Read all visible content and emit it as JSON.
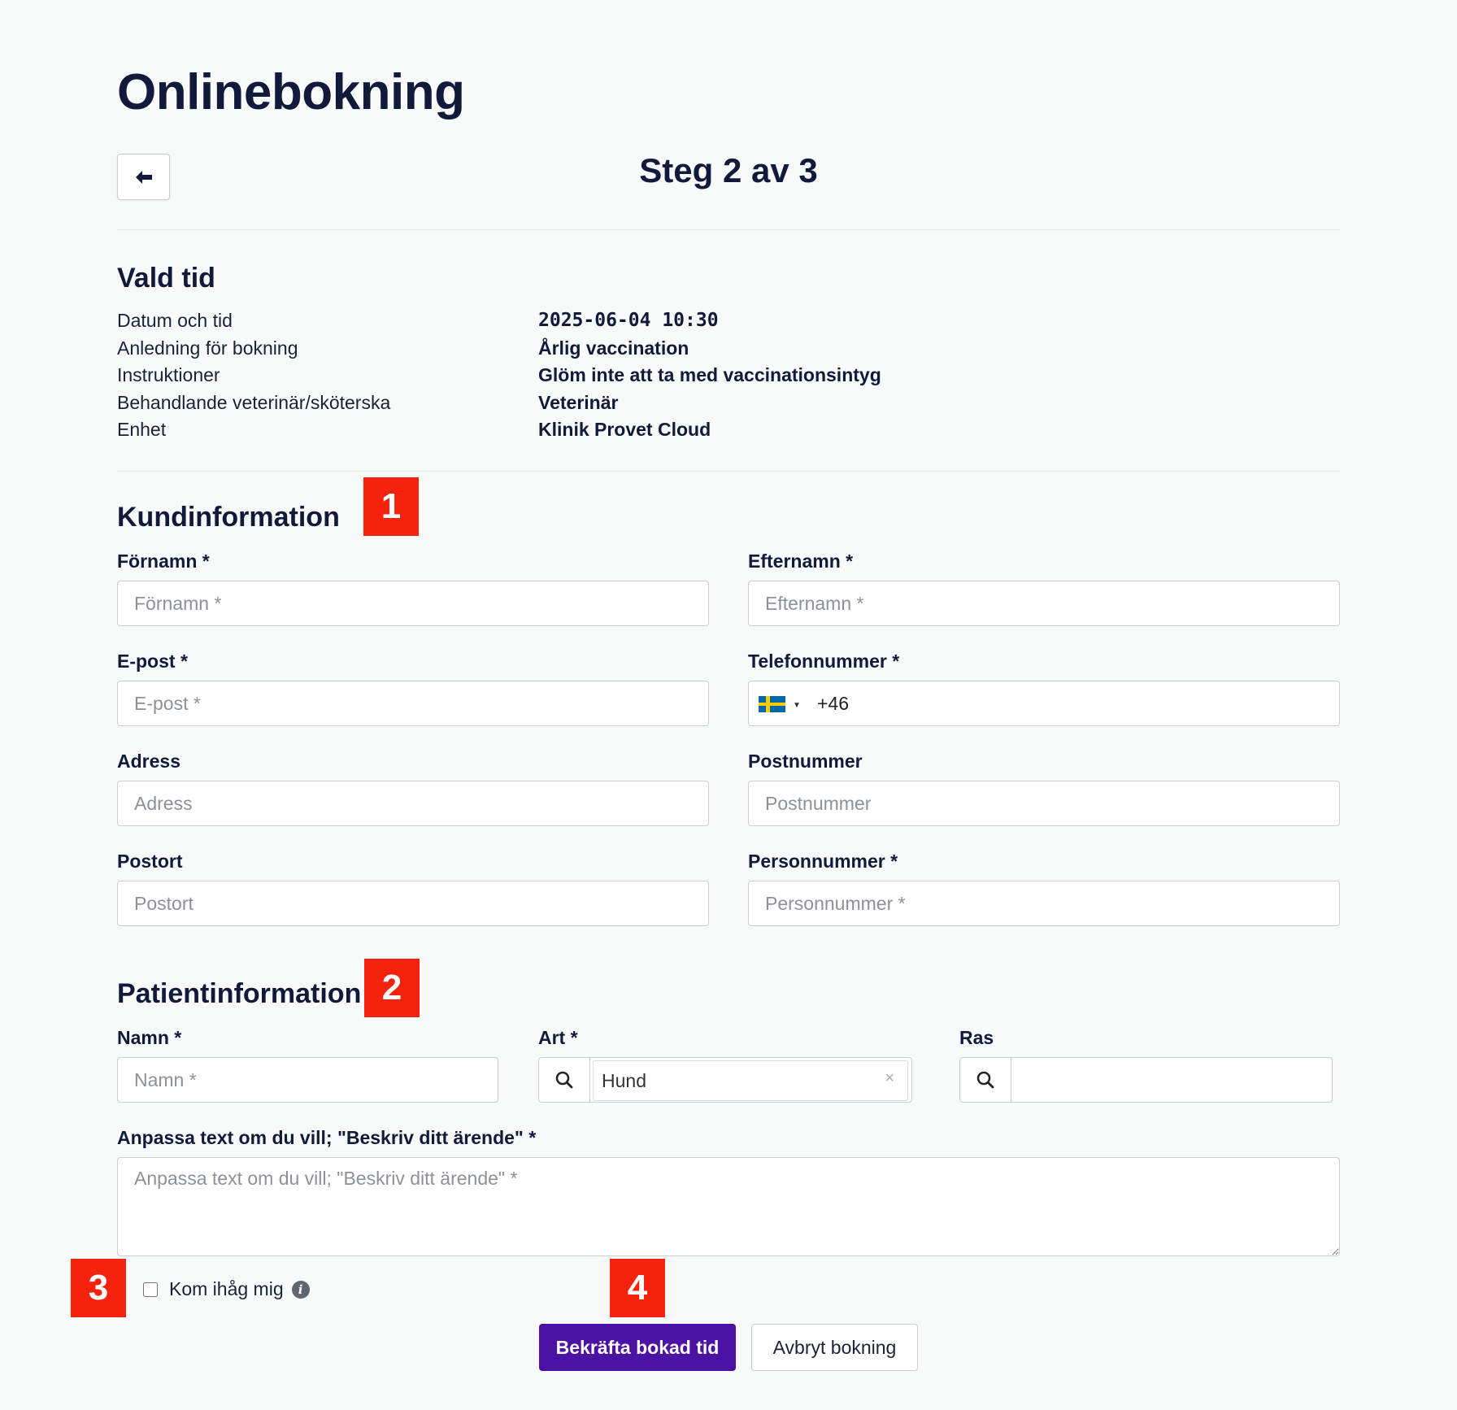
{
  "page": {
    "title": "Onlinebokning",
    "step": "Steg 2 av 3"
  },
  "chosen_time": {
    "heading": "Vald tid",
    "rows": [
      {
        "label": "Datum och tid",
        "value": "2025-06-04 10:30"
      },
      {
        "label": "Anledning för bokning",
        "value": "Årlig vaccination"
      },
      {
        "label": "Instruktioner",
        "value": "Glöm inte att ta med vaccinationsintyg"
      },
      {
        "label": "Behandlande veterinär/sköterska",
        "value": "Veterinär"
      },
      {
        "label": "Enhet",
        "value": "Klinik Provet Cloud"
      }
    ]
  },
  "customer": {
    "heading": "Kundinformation",
    "badge": "1",
    "first_name": {
      "label": "Förnamn *",
      "placeholder": "Förnamn *"
    },
    "last_name": {
      "label": "Efternamn *",
      "placeholder": "Efternamn *"
    },
    "email": {
      "label": "E-post *",
      "placeholder": "E-post *"
    },
    "phone": {
      "label": "Telefonnummer *",
      "country_code": "+46",
      "flag_icon": "sweden-flag-icon"
    },
    "address": {
      "label": "Adress",
      "placeholder": "Adress"
    },
    "postal_code": {
      "label": "Postnummer",
      "placeholder": "Postnummer"
    },
    "city": {
      "label": "Postort",
      "placeholder": "Postort"
    },
    "personal_number": {
      "label": "Personnummer *",
      "placeholder": "Personnummer *"
    }
  },
  "patient": {
    "heading": "Patientinformation",
    "badge": "2",
    "name": {
      "label": "Namn *",
      "placeholder": "Namn *"
    },
    "species": {
      "label": "Art *",
      "value": "Hund",
      "clear": "×"
    },
    "breed": {
      "label": "Ras",
      "value": ""
    },
    "description": {
      "label": "Anpassa text om du vill; \"Beskriv ditt ärende\" *",
      "placeholder": "Anpassa text om du vill; \"Beskriv ditt ärende\" *"
    }
  },
  "footer": {
    "remember_label": "Kom ihåg mig",
    "info_icon_glyph": "i",
    "badge3": "3",
    "badge4": "4",
    "confirm": "Bekräfta bokad tid",
    "cancel": "Avbryt bokning"
  },
  "colors": {
    "primary": "#4b12a4",
    "badge": "#f5230e",
    "heading": "#111a3a"
  }
}
